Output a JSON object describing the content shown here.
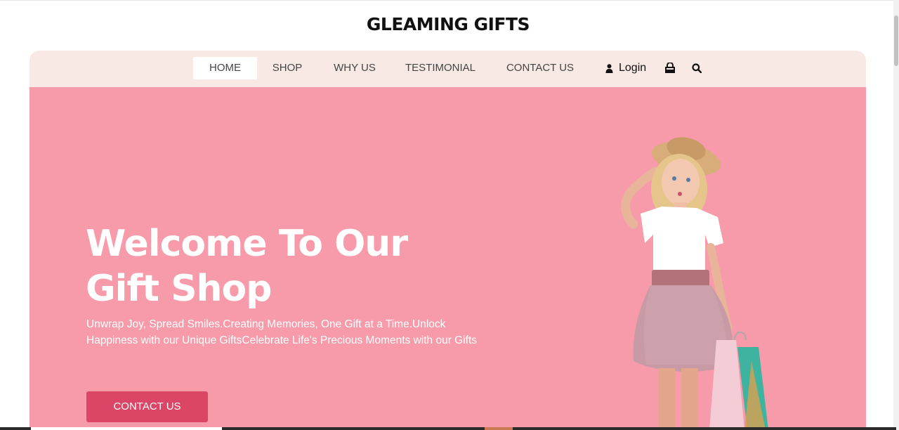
{
  "brand": {
    "name": "GLEAMING GIFTS"
  },
  "nav": {
    "items": [
      {
        "label": "HOME",
        "active": true
      },
      {
        "label": "SHOP",
        "active": false
      },
      {
        "label": "WHY US",
        "active": false
      },
      {
        "label": "TESTIMONIAL",
        "active": false
      },
      {
        "label": "CONTACT US",
        "active": false
      }
    ],
    "login_label": "Login",
    "icons": [
      "user-icon",
      "shopping-bag-icon",
      "search-icon"
    ]
  },
  "hero": {
    "title_line1": "Welcome To Our",
    "title_line2": "Gift Shop",
    "description": "Unwrap Joy, Spread Smiles.Creating Memories, One Gift at a Time.Unlock Happiness with our Unique GiftsCelebrate Life's Precious Moments with our Gifts",
    "cta_label": "CONTACT US"
  },
  "colors": {
    "nav_bg": "#f9e9e4",
    "hero_bg": "#f79aa9",
    "cta_bg": "#db4566",
    "text_dark": "#111111"
  }
}
